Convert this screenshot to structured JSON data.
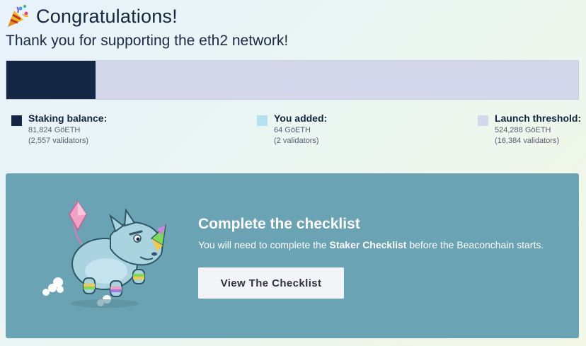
{
  "header": {
    "icon": "party-popper-icon",
    "title": "Congratulations!",
    "subtitle": "Thank you for supporting the eth2 network!"
  },
  "progress": {
    "staking_fraction": 0.1561,
    "added_fraction": 0.0001,
    "colors": {
      "staking": "#132745",
      "added": "#b5e2f1",
      "threshold": "#d4d8ea"
    }
  },
  "legend": {
    "staking": {
      "label": "Staking balance:",
      "amount": "81,824 GöETH",
      "validators": "(2,557 validators)"
    },
    "added": {
      "label": "You added:",
      "amount": "64 GöETH",
      "validators": "(2 validators)"
    },
    "threshold": {
      "label": "Launch threshold:",
      "amount": "524,288 GöETH",
      "validators": "(16,384 validators)"
    }
  },
  "checklist_card": {
    "illustration": "leslie-rhino-illustration",
    "title": "Complete the checklist",
    "text_before": "You will need to complete the ",
    "text_bold": "Staker Checklist",
    "text_after": " before the Beaconchain starts.",
    "button_label": "View The Checklist",
    "background": "#6aa4b4"
  }
}
